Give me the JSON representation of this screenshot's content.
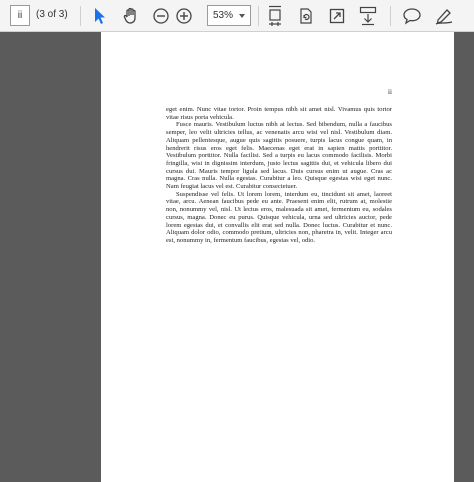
{
  "toolbar": {
    "page_input_value": "ii",
    "page_count_text": "(3 of 3)",
    "zoom_value": "53%",
    "icons": [
      "select-arrow-icon",
      "hand-icon",
      "zoom-out-icon",
      "zoom-in-icon",
      "fit-page-icon",
      "rotate-icon",
      "full-screen-icon",
      "save-download-icon",
      "comment-icon",
      "pen-icon"
    ],
    "colors": {
      "accent": "#1a73e8",
      "background": "#f4f4f4",
      "viewer_bg": "#5b5b5b"
    }
  },
  "document": {
    "page_number": "ii",
    "paragraphs": [
      {
        "indent": false,
        "text": "eget enim. Nunc vitae tortor. Proin tempus nibh sit amet nisl. Vivamus quis tortor vitae risus porta vehicula."
      },
      {
        "indent": true,
        "text": "Fusce mauris. Vestibulum luctus nibh at lectus. Sed bibendum, nulla a faucibus semper, leo velit ultricies tellus, ac venenatis arcu wisi vel nisl. Vestibulum diam. Aliquam pellentesque, augue quis sagittis posuere, turpis lacus congue quam, in hendrerit risus eros eget felis. Maecenas eget erat in sapien mattis porttitor. Vestibulum porttitor. Nulla facilisi. Sed a turpis eu lacus commodo facilisis. Morbi fringilla, wisi in dignissim interdum, justo lectus sagittis dui, et vehicula libero dui cursus dui. Mauris tempor ligula sed lacus. Duis cursus enim ut augue. Cras ac magna. Cras nulla. Nulla egestas. Curabitur a leo. Quisque egestas wisi eget nunc. Nam feugiat lacus vel est. Curabitur consectetuer."
      },
      {
        "indent": true,
        "text": "Suspendisse vel felis. Ut lorem lorem, interdum eu, tincidunt sit amet, laoreet vitae, arcu. Aenean faucibus pede eu ante. Praesent enim elit, rutrum at, molestie non, nonummy vel, nisl. Ut lectus eros, malesuada sit amet, fermentum eu, sodales cursus, magna. Donec eu purus. Quisque vehicula, urna sed ultricies auctor, pede lorem egestas dui, et convallis elit erat sed nulla. Donec luctus. Curabitur et nunc. Aliquam dolor odio, commodo pretium, ultricies non, pharetra in, velit. Integer arcu est, nonummy in, fermentum faucibus, egestas vel, odio."
      }
    ]
  }
}
